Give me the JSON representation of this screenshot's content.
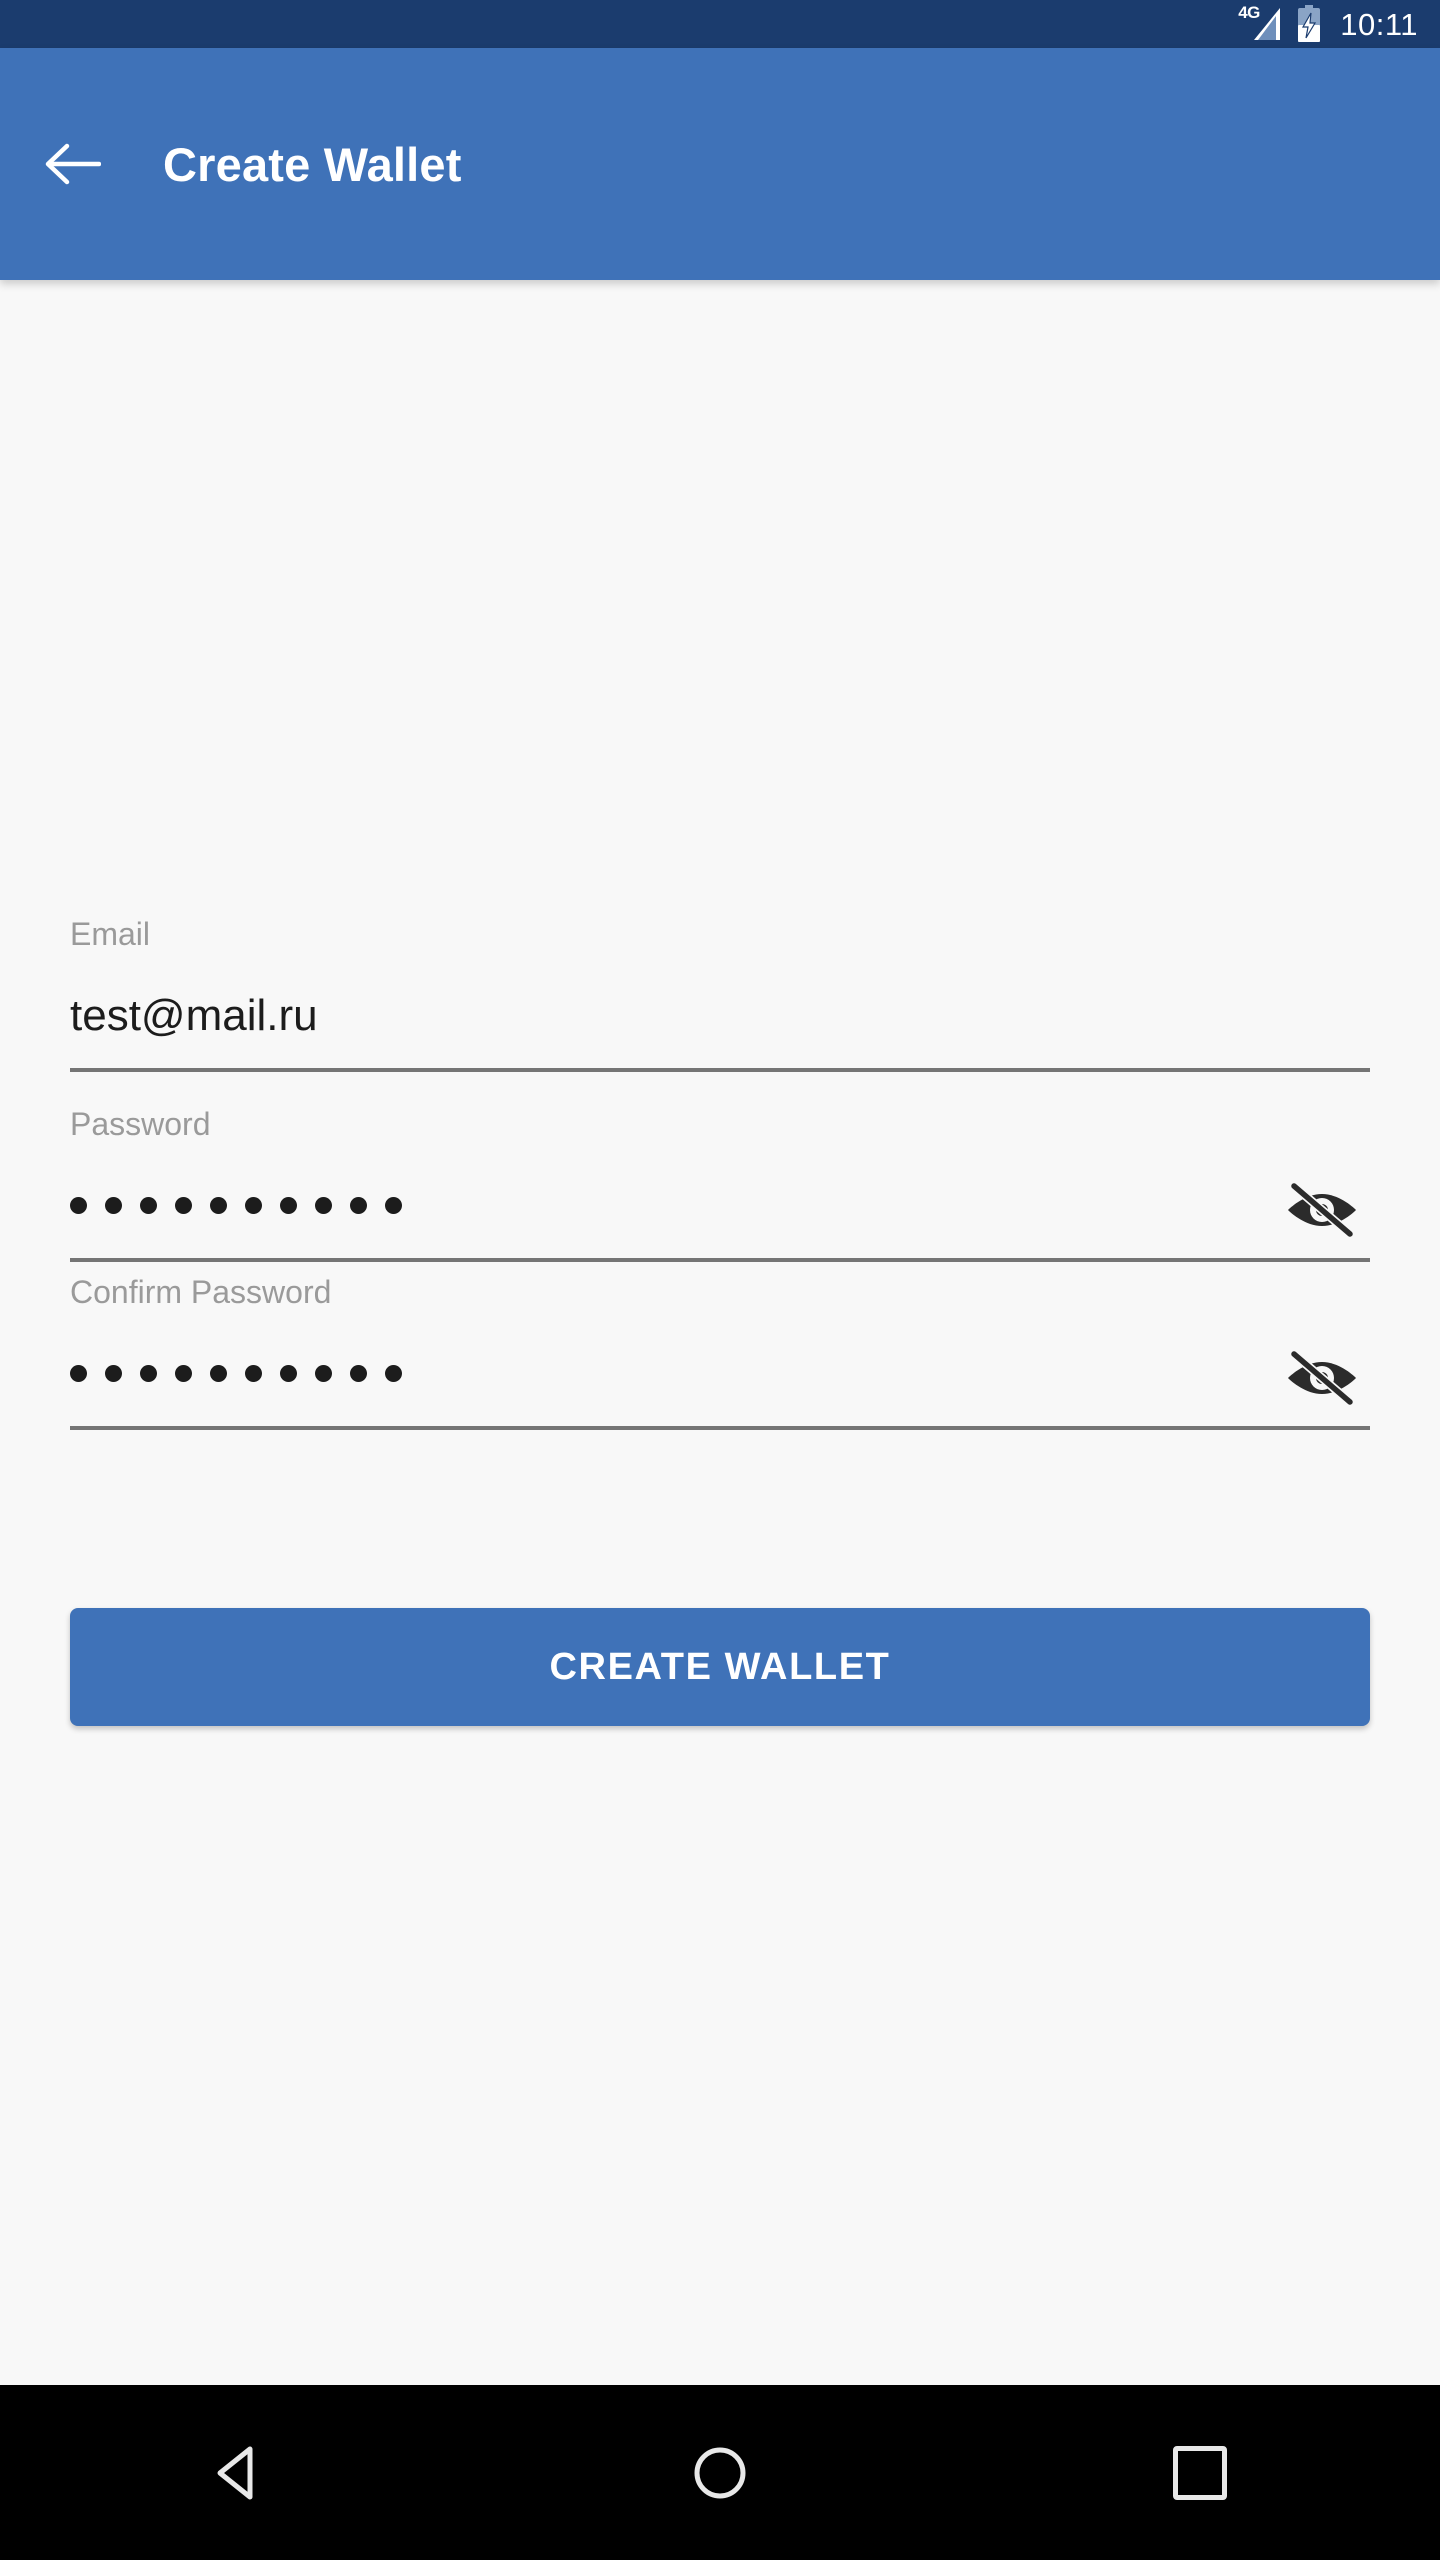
{
  "status_bar": {
    "network_label": "4G",
    "time": "10:11",
    "signal_icon": "signal-bars-icon",
    "battery_icon": "battery-charging-icon",
    "background_color": "#1b3c6e",
    "text_color": "#ffffff"
  },
  "app_bar": {
    "title": "Create Wallet",
    "back_icon": "arrow-back-icon",
    "background_color": "#3f72b8",
    "text_color": "#ffffff"
  },
  "form": {
    "email": {
      "label": "Email",
      "value": "test@mail.ru",
      "placeholder": "Email"
    },
    "password": {
      "label": "Password",
      "value": "••••••••••",
      "placeholder": "Password",
      "dot_count": 10,
      "toggle_icon": "visibility-off-icon",
      "masked": true
    },
    "confirm_password": {
      "label": "Confirm Password",
      "value": "••••••••••",
      "placeholder": "Confirm Password",
      "dot_count": 10,
      "toggle_icon": "visibility-off-icon",
      "masked": true
    },
    "submit_label": "CREATE WALLET",
    "submit_color": "#3f72b8",
    "label_color": "#9a9a9a",
    "value_color": "#1c1c1c",
    "underline_color": "#757575"
  },
  "nav_bar": {
    "back_icon": "nav-back-triangle-icon",
    "home_icon": "nav-home-circle-icon",
    "recents_icon": "nav-recents-square-icon",
    "background_color": "#000000"
  },
  "page": {
    "background_color": "#f8f8f8"
  }
}
